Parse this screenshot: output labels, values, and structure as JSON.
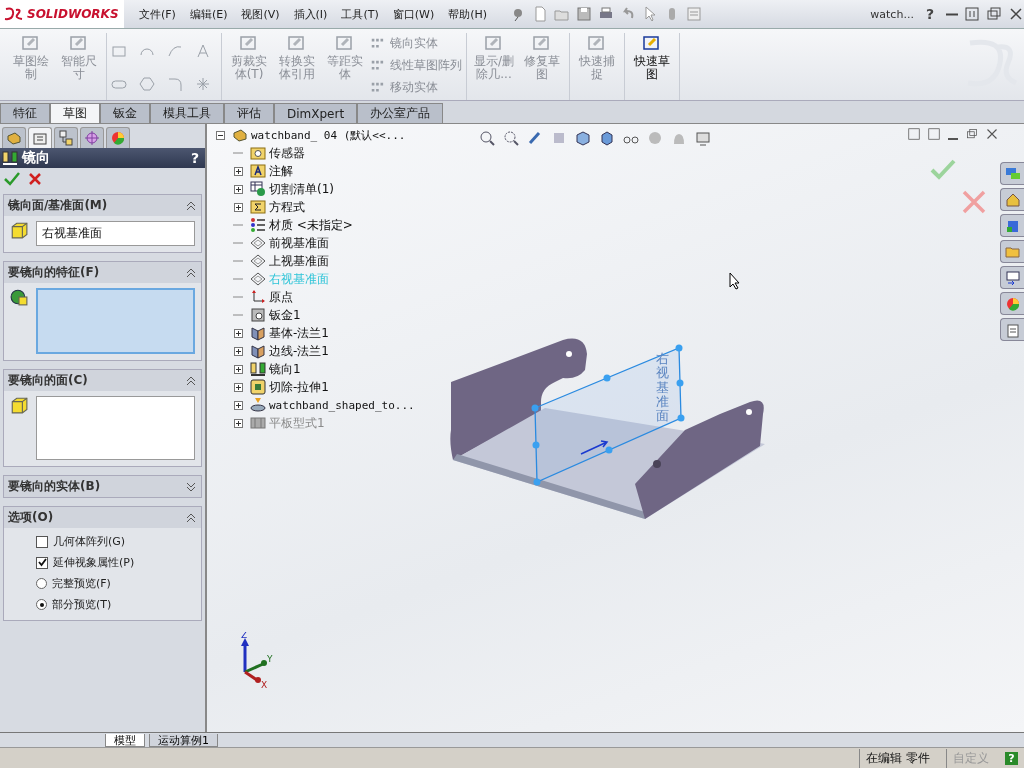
{
  "app": {
    "logo": "SOLIDWORKS",
    "menu": [
      "文件(F)",
      "编辑(E)",
      "视图(V)",
      "插入(I)",
      "工具(T)",
      "窗口(W)",
      "帮助(H)"
    ],
    "doc_title": "watch...",
    "help": "?"
  },
  "ribbon": {
    "groups": [
      {
        "items": [
          {
            "kind": "large",
            "label": "草图绘制",
            "disabled": true
          },
          {
            "kind": "large",
            "label": "智能尺寸",
            "disabled": true
          }
        ]
      },
      {
        "items": [
          {
            "kind": "tools",
            "disabled": true
          }
        ]
      },
      {
        "items": [
          {
            "kind": "large",
            "label": "剪裁实体(T)",
            "disabled": true
          },
          {
            "kind": "large",
            "label": "转换实体引用",
            "disabled": true
          },
          {
            "kind": "large",
            "label": "等距实体",
            "disabled": true
          },
          {
            "kind": "stack",
            "disabled": true,
            "rows": [
              "镜向实体",
              "线性草图阵列",
              "移动实体"
            ]
          }
        ]
      },
      {
        "items": [
          {
            "kind": "large",
            "label": "显示/删除几...",
            "disabled": true
          },
          {
            "kind": "large",
            "label": "修复草图",
            "disabled": true
          }
        ]
      },
      {
        "items": [
          {
            "kind": "large",
            "label": "快速捕捉",
            "disabled": true
          }
        ]
      },
      {
        "items": [
          {
            "kind": "large",
            "label": "快速草图",
            "disabled": false
          }
        ]
      }
    ]
  },
  "command_tabs": [
    {
      "label": "特征",
      "selected": false
    },
    {
      "label": "草图",
      "selected": true
    },
    {
      "label": "钣金",
      "selected": false
    },
    {
      "label": "模具工具",
      "selected": false
    },
    {
      "label": "评估",
      "selected": false
    },
    {
      "label": "DimXpert",
      "selected": false
    },
    {
      "label": "办公室产品",
      "selected": false
    }
  ],
  "panel_tabs": [
    {
      "kind": "feature",
      "selected": false
    },
    {
      "kind": "property",
      "selected": true
    },
    {
      "kind": "config",
      "selected": false
    },
    {
      "kind": "dim",
      "selected": false
    },
    {
      "kind": "display",
      "selected": false
    }
  ],
  "property_manager": {
    "title": "镜向",
    "help": "?",
    "sections": [
      {
        "title": "镜向面/基准面(M)",
        "expanded": true,
        "kind": "face",
        "value": "右视基准面",
        "active": false
      },
      {
        "title": "要镜向的特征(F)",
        "expanded": true,
        "kind": "feature",
        "active": true
      },
      {
        "title": "要镜向的面(C)",
        "expanded": true,
        "kind": "face",
        "active": false
      },
      {
        "title": "要镜向的实体(B)",
        "expanded": false
      },
      {
        "title": "选项(O)",
        "expanded": true,
        "kind": "options",
        "options": [
          {
            "kind": "checkbox",
            "label": "几何体阵列(G)",
            "checked": false
          },
          {
            "kind": "checkbox",
            "label": "延伸视象属性(P)",
            "checked": true
          },
          {
            "kind": "radio",
            "label": "完整预览(F)",
            "selected": false
          },
          {
            "kind": "radio",
            "label": "部分预览(T)",
            "selected": true
          }
        ]
      }
    ]
  },
  "feature_tree": {
    "root": "watchband_ 04  (默认<<...",
    "expanded": true,
    "children": [
      {
        "label": "传感器",
        "kind": "sensor",
        "expandable": false,
        "selected": false,
        "suppressed": false
      },
      {
        "label": "注解",
        "kind": "annotation",
        "expandable": true,
        "selected": false,
        "suppressed": false
      },
      {
        "label": "切割清单(1)",
        "kind": "cutlist",
        "expandable": true,
        "selected": false,
        "suppressed": false
      },
      {
        "label": "方程式",
        "kind": "equation",
        "expandable": true,
        "selected": false,
        "suppressed": false
      },
      {
        "label": "材质 <未指定>",
        "kind": "material",
        "expandable": false,
        "selected": false,
        "suppressed": false
      },
      {
        "label": "前视基准面",
        "kind": "plane",
        "expandable": false,
        "selected": false,
        "suppressed": false
      },
      {
        "label": "上视基准面",
        "kind": "plane",
        "expandable": false,
        "selected": false,
        "suppressed": false
      },
      {
        "label": "右视基准面",
        "kind": "plane",
        "expandable": false,
        "selected": true,
        "suppressed": false
      },
      {
        "label": "原点",
        "kind": "origin",
        "expandable": false,
        "selected": false,
        "suppressed": false
      },
      {
        "label": "钣金1",
        "kind": "sheetmetal",
        "expandable": false,
        "selected": false,
        "suppressed": false
      },
      {
        "label": "基体-法兰1",
        "kind": "flange",
        "expandable": true,
        "selected": false,
        "suppressed": false
      },
      {
        "label": "边线-法兰1",
        "kind": "flange",
        "expandable": true,
        "selected": false,
        "suppressed": false
      },
      {
        "label": "镜向1",
        "kind": "mirror",
        "expandable": true,
        "selected": false,
        "suppressed": false
      },
      {
        "label": "切除-拉伸1",
        "kind": "cut",
        "expandable": true,
        "selected": false,
        "suppressed": false
      },
      {
        "label": "watchband_shaped_to...",
        "kind": "library",
        "expandable": true,
        "selected": false,
        "suppressed": false
      },
      {
        "label": "平板型式1",
        "kind": "flat",
        "expandable": true,
        "selected": false,
        "suppressed": true
      }
    ]
  },
  "viewport": {
    "plane_label": "右视基准面",
    "triad": [
      "Z",
      "Y",
      "X"
    ]
  },
  "bottom_tabs": [
    {
      "label": "模型",
      "selected": true
    },
    {
      "label": "运动算例1",
      "selected": false
    }
  ],
  "status_bar": {
    "mode": "在编辑 零件",
    "units": "自定义"
  }
}
